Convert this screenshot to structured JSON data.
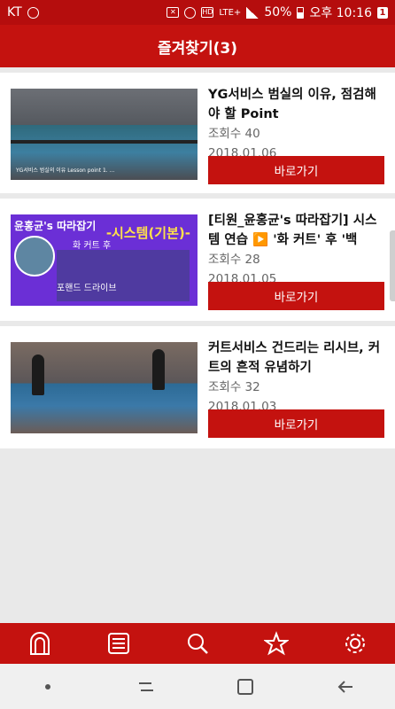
{
  "status_bar": {
    "carrier": "KT",
    "battery": "50%",
    "time": "오후 10:16",
    "network": "LTE+",
    "notification_count": "1"
  },
  "header": {
    "title": "즐겨찾기(3)"
  },
  "favorites": [
    {
      "title": "YG서비스 범실의 이유, 점검해야 할 Point",
      "views": "조회수 40",
      "date": "2018.01.06",
      "button": "바로가기"
    },
    {
      "title": "[티원_윤홍균's 따라잡기] 시스템 연습 ▶️ '화 커트' 후 '백",
      "views": "조회수 28",
      "date": "2018.01.05",
      "button": "바로가기"
    },
    {
      "title": "커트서비스 건드리는 리시브, 커트의 흔적 유념하기",
      "views": "조회수 32",
      "date": "2018.01.03",
      "button": "바로가기"
    }
  ],
  "thumbnails": {
    "t1_text": "YG서비스 범실의 이유\nLesson point\n1. ...",
    "t2_brand": "윤홍균's 따라잡기",
    "t2_system": "-시스템(기본)-",
    "t2_label1": "화 커트 후",
    "t2_label2": "포핸드 드라이브"
  },
  "bottom_nav": [
    "home-icon",
    "list-icon",
    "search-icon",
    "star-icon",
    "settings-icon"
  ],
  "colors": {
    "primary": "#c4120f",
    "status_bar": "#b50d0d"
  }
}
